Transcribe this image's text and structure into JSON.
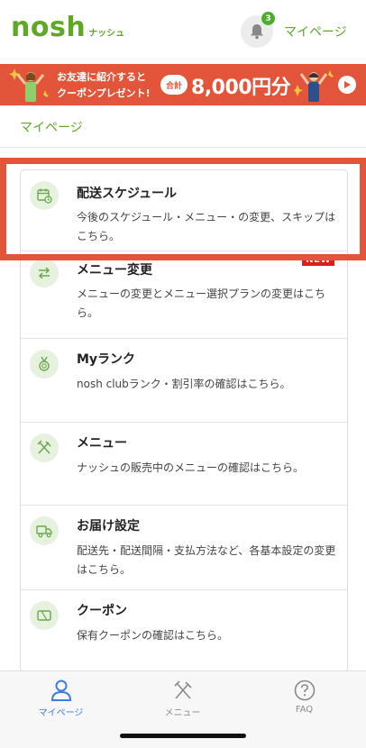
{
  "header": {
    "logo_main": "nosh",
    "logo_sub": "ナッシュ",
    "notification_count": "3",
    "mypage_label": "マイページ"
  },
  "banner": {
    "line1": "お友達に紹介すると",
    "line2": "クーポンプレゼント!",
    "pill": "合計",
    "amount": "8,000円分"
  },
  "breadcrumb": "マイページ",
  "menu": {
    "items": [
      {
        "title": "配送スケジュール",
        "desc": "今後のスケジュール・メニュー・の変更、スキップはこちら。",
        "icon": "calendar-clock-icon"
      },
      {
        "title": "メニュー変更",
        "desc": "メニューの変更とメニュー選択プランの変更はこちら。",
        "icon": "swap-arrows-icon",
        "tag": "NEW"
      },
      {
        "title": "Myランク",
        "desc": "nosh clubランク・割引率の確認はこちら。",
        "icon": "medal-icon"
      },
      {
        "title": "メニュー",
        "desc": "ナッシュの販売中のメニューの確認はこちら。",
        "icon": "fork-knife-icon"
      },
      {
        "title": "お届け設定",
        "desc": "配送先・配送間隔・支払方法など、各基本設定の変更はこちら。",
        "icon": "delivery-truck-icon"
      },
      {
        "title": "クーポン",
        "desc": "保有クーポンの確認はこちら。",
        "icon": "coupon-icon"
      }
    ]
  },
  "tabbar": {
    "tabs": [
      {
        "label": "マイページ",
        "icon": "person-icon",
        "active": true
      },
      {
        "label": "メニュー",
        "icon": "fork-knife-icon"
      },
      {
        "label": "FAQ",
        "icon": "question-icon"
      }
    ]
  },
  "colors": {
    "brand_green": "#5fa826",
    "banner_red": "#e2553a",
    "active_tab_blue": "#3b7de0",
    "new_tag_red": "#d9201a"
  }
}
